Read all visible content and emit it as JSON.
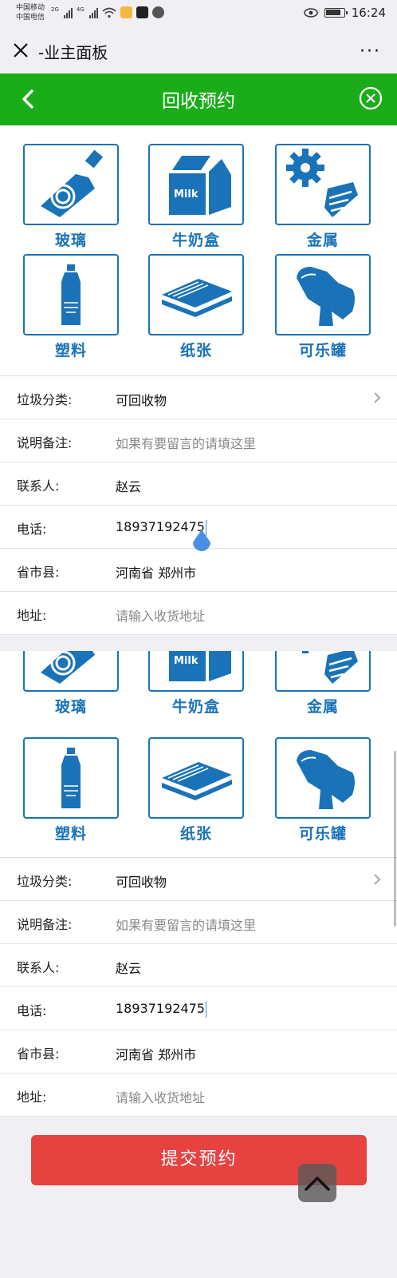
{
  "status_bar": {
    "carrier_1": "中国移动",
    "carrier_2": "中国电信",
    "signal_1": "2G",
    "signal_2": "4G",
    "time": "16:24"
  },
  "wechat_bar": {
    "title": "-业主面板",
    "more": "···"
  },
  "header": {
    "title": "回收预约"
  },
  "categories": [
    {
      "label": "玻璃",
      "icon": "glass-bottle-icon"
    },
    {
      "label": "牛奶盒",
      "icon": "milk-carton-icon"
    },
    {
      "label": "金属",
      "icon": "metal-gear-screw-icon"
    },
    {
      "label": "塑料",
      "icon": "plastic-bottle-icon"
    },
    {
      "label": "纸张",
      "icon": "paper-stack-icon"
    },
    {
      "label": "可乐罐",
      "icon": "crushed-can-icon"
    }
  ],
  "milk_text": "Milk",
  "form": {
    "type_label": "垃圾分类:",
    "type_value": "可回收物",
    "note_label": "说明备注:",
    "note_placeholder": "如果有要留言的请填这里",
    "contact_label": "联系人:",
    "contact_value": "赵云",
    "phone_label": "电话:",
    "phone_value": "18937192475",
    "region_label": "省市县:",
    "region_value": "河南省 郑州市",
    "address_label": "地址:",
    "address_placeholder": "请输入收货地址"
  },
  "submit_label": "提交预约",
  "colors": {
    "header_green": "#1aad19",
    "icon_blue": "#1a73b8",
    "submit_red": "#e64340"
  }
}
